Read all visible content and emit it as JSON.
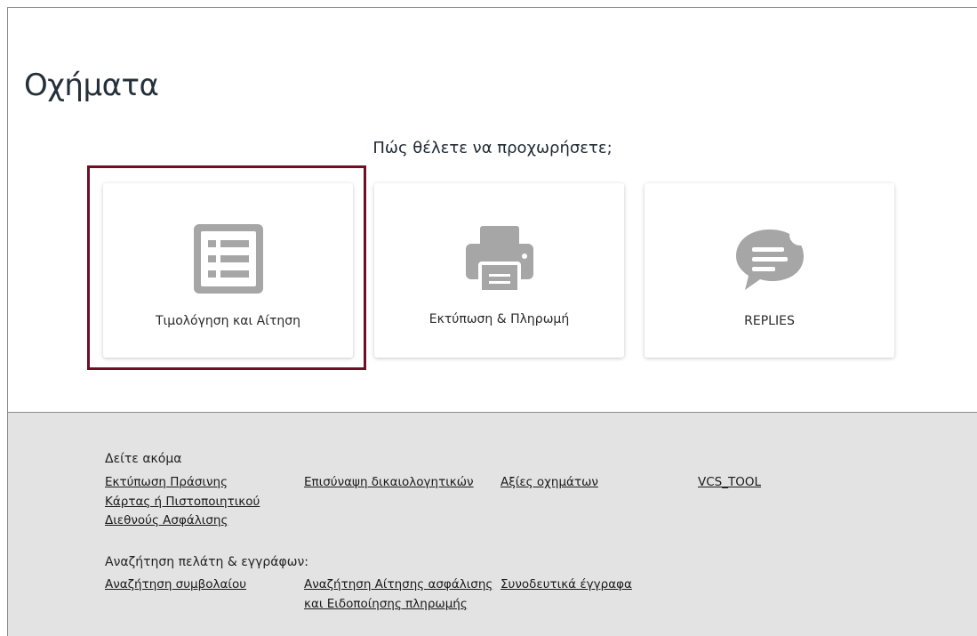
{
  "page": {
    "title": "Οχήματα",
    "question": "Πώς θέλετε να προχωρήσετε;"
  },
  "cards": [
    {
      "label": "Τιμολόγηση και Αίτηση",
      "icon": "list-icon"
    },
    {
      "label": "Εκτύπωση & Πληρωμή",
      "icon": "printer-icon"
    },
    {
      "label": "REPLIES",
      "icon": "chat-bubble-icon"
    }
  ],
  "footer": {
    "see_also": {
      "title": "Δείτε ακόμα",
      "links": [
        "Εκτύπωση Πράσινης Κάρτας ή Πιστοποιητικού Διεθνούς Ασφάλισης",
        "Επισύναψη δικαιολογητικών",
        "Αξίες οχημάτων",
        "VCS_TOOL"
      ]
    },
    "search": {
      "title": "Αναζήτηση πελάτη & εγγράφων:",
      "links": [
        "Αναζήτηση συμβολαίου",
        "Αναζήτηση Αίτησης ασφάλισης και Ειδοποίησης πληρωμής",
        "Συνοδευτικά έγγραφα"
      ]
    }
  },
  "colors": {
    "icon_gray": "#a6a6a6",
    "highlight_border": "#6e0f24",
    "footer_bg": "#e3e3e3"
  }
}
